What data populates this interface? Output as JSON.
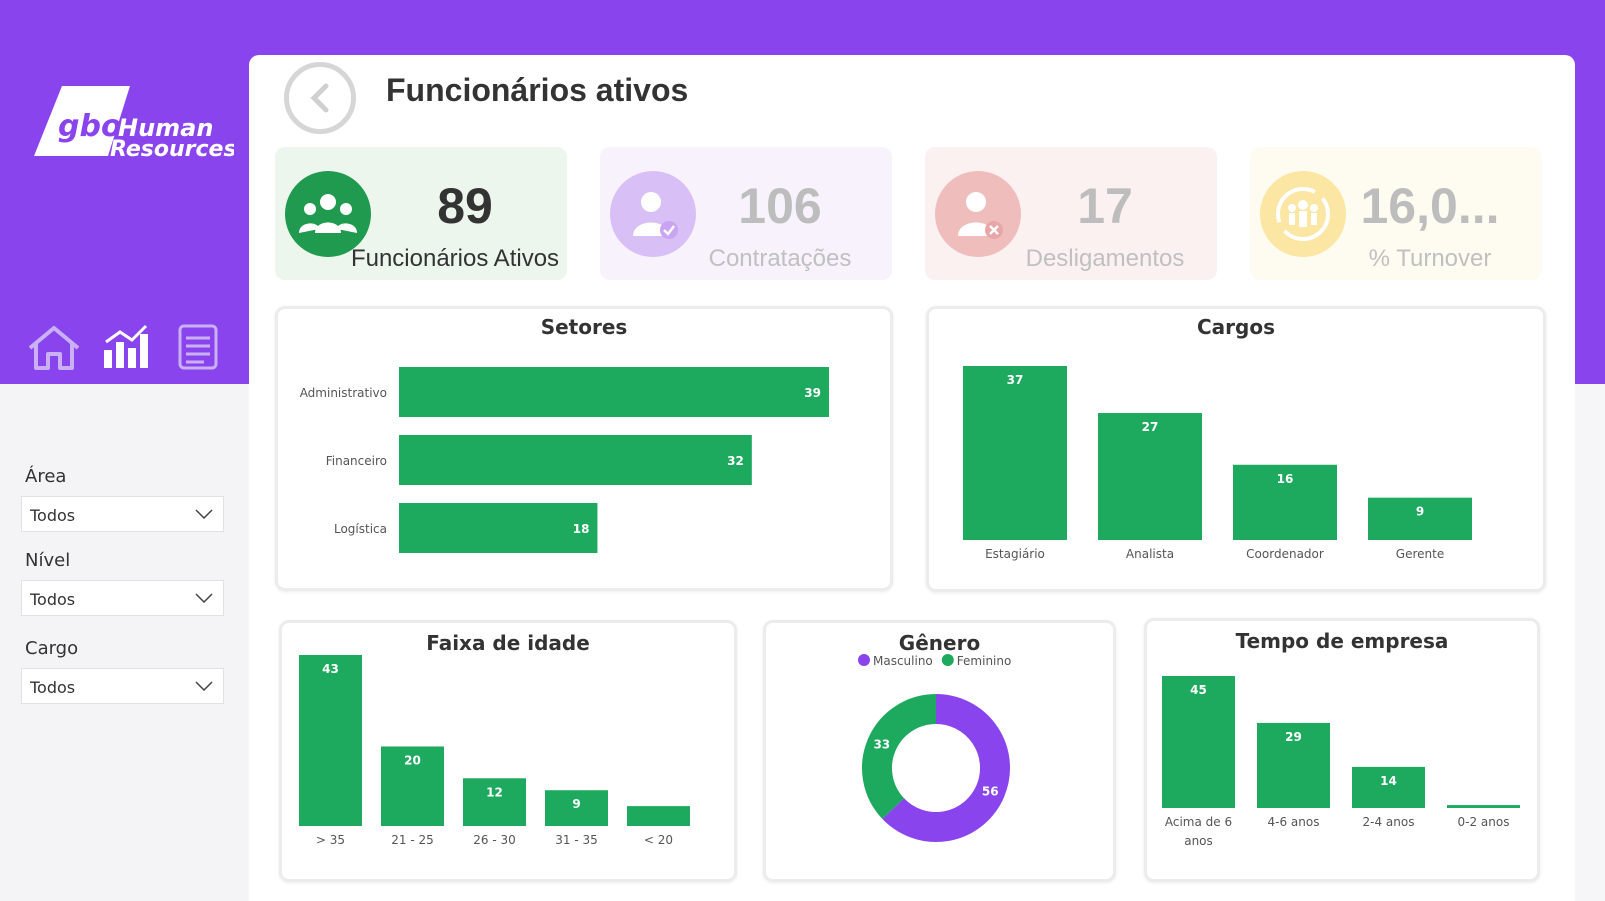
{
  "brand": {
    "logo_text_1": "gbo",
    "logo_text_2": "Human",
    "logo_text_3": "Resources",
    "purple": "#8a44ee",
    "green": "#1daa5f"
  },
  "nav": {
    "icons": [
      "home-icon",
      "analytics-chart-icon",
      "report-list-icon"
    ]
  },
  "filters": [
    {
      "label": "Área",
      "value": "Todos"
    },
    {
      "label": "Nível",
      "value": "Todos"
    },
    {
      "label": "Cargo",
      "value": "Todos"
    }
  ],
  "header": {
    "title": "Funcionários ativos"
  },
  "kpis": [
    {
      "value": "89",
      "label": "Funcionários Ativos",
      "icon": "people-group-icon"
    },
    {
      "value": "106",
      "label": "Contratações",
      "icon": "person-check-icon"
    },
    {
      "value": "17",
      "label": "Desligamentos",
      "icon": "person-remove-icon"
    },
    {
      "value": "16,0...",
      "label": "% Turnover",
      "icon": "turnover-cycle-icon"
    }
  ],
  "chart_data": [
    {
      "id": "setores",
      "type": "bar",
      "orientation": "horizontal",
      "title": "Setores",
      "categories": [
        "Administrativo",
        "Financeiro",
        "Logística"
      ],
      "values": [
        39,
        32,
        18
      ]
    },
    {
      "id": "cargos",
      "type": "bar",
      "title": "Cargos",
      "categories": [
        "Estagiário",
        "Analista",
        "Coordenador",
        "Gerente"
      ],
      "values": [
        37,
        27,
        16,
        9
      ]
    },
    {
      "id": "idade",
      "type": "bar",
      "title": "Faixa de idade",
      "categories": [
        "> 35",
        "21 - 25",
        "26 - 30",
        "31 - 35",
        "< 20"
      ],
      "values": [
        43,
        20,
        12,
        9,
        5
      ]
    },
    {
      "id": "genero",
      "type": "pie",
      "title": "Gênero",
      "series": [
        {
          "name": "Masculino",
          "value": 56,
          "color": "#8a44ee"
        },
        {
          "name": "Feminino",
          "value": 33,
          "color": "#1daa5f"
        }
      ],
      "legend": "top"
    },
    {
      "id": "tempo",
      "type": "bar",
      "title": "Tempo de empresa",
      "categories": [
        "Acima de 6 anos",
        "4-6 anos",
        "2-4 anos",
        "0-2 anos"
      ],
      "values": [
        45,
        29,
        14,
        1
      ]
    }
  ]
}
